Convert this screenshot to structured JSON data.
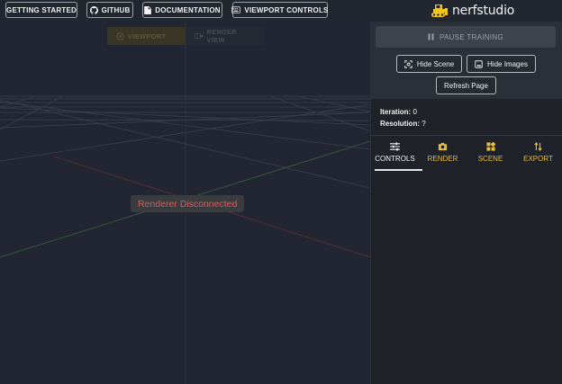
{
  "topbar": {
    "getting_started": "GETTING STARTED",
    "github": "GITHUB",
    "documentation": "DOCUMENTATION",
    "viewport_controls": "VIEWPORT CONTROLS",
    "logo_text": "nerfstudio"
  },
  "viewport": {
    "tabs": [
      {
        "label": "VIEWPORT",
        "icon": "viewport-icon",
        "active": true
      },
      {
        "label": "RENDER VIEW",
        "icon": "video-camera-icon",
        "active": false
      }
    ],
    "status": "Renderer Disconnected"
  },
  "panel": {
    "pause_label": "PAUSE TRAINING",
    "hide_scene_label": "Hide Scene",
    "hide_images_label": "Hide Images",
    "refresh_label": "Refresh Page",
    "iteration_label": "Iteration:",
    "iteration_value": "0",
    "resolution_label": "Resolution:",
    "resolution_value": "?",
    "tabs": [
      {
        "label": "CONTROLS",
        "icon": "sliders-icon",
        "active": true
      },
      {
        "label": "RENDER",
        "icon": "camera-icon",
        "active": false
      },
      {
        "label": "SCENE",
        "icon": "widgets-icon",
        "active": false
      },
      {
        "label": "EXPORT",
        "icon": "import-export-icon",
        "active": false
      }
    ]
  },
  "colors": {
    "accent": "#e9bb3c",
    "background": "#202430",
    "panel": "#2b2f38",
    "error_text": "#d0605c"
  }
}
